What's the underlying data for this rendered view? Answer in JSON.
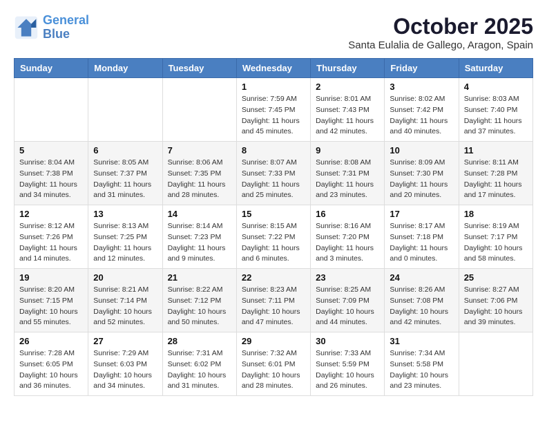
{
  "header": {
    "logo_line1": "General",
    "logo_line2": "Blue",
    "month": "October 2025",
    "location": "Santa Eulalia de Gallego, Aragon, Spain"
  },
  "days_of_week": [
    "Sunday",
    "Monday",
    "Tuesday",
    "Wednesday",
    "Thursday",
    "Friday",
    "Saturday"
  ],
  "weeks": [
    [
      {
        "day": "",
        "info": ""
      },
      {
        "day": "",
        "info": ""
      },
      {
        "day": "",
        "info": ""
      },
      {
        "day": "1",
        "info": "Sunrise: 7:59 AM\nSunset: 7:45 PM\nDaylight: 11 hours\nand 45 minutes."
      },
      {
        "day": "2",
        "info": "Sunrise: 8:01 AM\nSunset: 7:43 PM\nDaylight: 11 hours\nand 42 minutes."
      },
      {
        "day": "3",
        "info": "Sunrise: 8:02 AM\nSunset: 7:42 PM\nDaylight: 11 hours\nand 40 minutes."
      },
      {
        "day": "4",
        "info": "Sunrise: 8:03 AM\nSunset: 7:40 PM\nDaylight: 11 hours\nand 37 minutes."
      }
    ],
    [
      {
        "day": "5",
        "info": "Sunrise: 8:04 AM\nSunset: 7:38 PM\nDaylight: 11 hours\nand 34 minutes."
      },
      {
        "day": "6",
        "info": "Sunrise: 8:05 AM\nSunset: 7:37 PM\nDaylight: 11 hours\nand 31 minutes."
      },
      {
        "day": "7",
        "info": "Sunrise: 8:06 AM\nSunset: 7:35 PM\nDaylight: 11 hours\nand 28 minutes."
      },
      {
        "day": "8",
        "info": "Sunrise: 8:07 AM\nSunset: 7:33 PM\nDaylight: 11 hours\nand 25 minutes."
      },
      {
        "day": "9",
        "info": "Sunrise: 8:08 AM\nSunset: 7:31 PM\nDaylight: 11 hours\nand 23 minutes."
      },
      {
        "day": "10",
        "info": "Sunrise: 8:09 AM\nSunset: 7:30 PM\nDaylight: 11 hours\nand 20 minutes."
      },
      {
        "day": "11",
        "info": "Sunrise: 8:11 AM\nSunset: 7:28 PM\nDaylight: 11 hours\nand 17 minutes."
      }
    ],
    [
      {
        "day": "12",
        "info": "Sunrise: 8:12 AM\nSunset: 7:26 PM\nDaylight: 11 hours\nand 14 minutes."
      },
      {
        "day": "13",
        "info": "Sunrise: 8:13 AM\nSunset: 7:25 PM\nDaylight: 11 hours\nand 12 minutes."
      },
      {
        "day": "14",
        "info": "Sunrise: 8:14 AM\nSunset: 7:23 PM\nDaylight: 11 hours\nand 9 minutes."
      },
      {
        "day": "15",
        "info": "Sunrise: 8:15 AM\nSunset: 7:22 PM\nDaylight: 11 hours\nand 6 minutes."
      },
      {
        "day": "16",
        "info": "Sunrise: 8:16 AM\nSunset: 7:20 PM\nDaylight: 11 hours\nand 3 minutes."
      },
      {
        "day": "17",
        "info": "Sunrise: 8:17 AM\nSunset: 7:18 PM\nDaylight: 11 hours\nand 0 minutes."
      },
      {
        "day": "18",
        "info": "Sunrise: 8:19 AM\nSunset: 7:17 PM\nDaylight: 10 hours\nand 58 minutes."
      }
    ],
    [
      {
        "day": "19",
        "info": "Sunrise: 8:20 AM\nSunset: 7:15 PM\nDaylight: 10 hours\nand 55 minutes."
      },
      {
        "day": "20",
        "info": "Sunrise: 8:21 AM\nSunset: 7:14 PM\nDaylight: 10 hours\nand 52 minutes."
      },
      {
        "day": "21",
        "info": "Sunrise: 8:22 AM\nSunset: 7:12 PM\nDaylight: 10 hours\nand 50 minutes."
      },
      {
        "day": "22",
        "info": "Sunrise: 8:23 AM\nSunset: 7:11 PM\nDaylight: 10 hours\nand 47 minutes."
      },
      {
        "day": "23",
        "info": "Sunrise: 8:25 AM\nSunset: 7:09 PM\nDaylight: 10 hours\nand 44 minutes."
      },
      {
        "day": "24",
        "info": "Sunrise: 8:26 AM\nSunset: 7:08 PM\nDaylight: 10 hours\nand 42 minutes."
      },
      {
        "day": "25",
        "info": "Sunrise: 8:27 AM\nSunset: 7:06 PM\nDaylight: 10 hours\nand 39 minutes."
      }
    ],
    [
      {
        "day": "26",
        "info": "Sunrise: 7:28 AM\nSunset: 6:05 PM\nDaylight: 10 hours\nand 36 minutes."
      },
      {
        "day": "27",
        "info": "Sunrise: 7:29 AM\nSunset: 6:03 PM\nDaylight: 10 hours\nand 34 minutes."
      },
      {
        "day": "28",
        "info": "Sunrise: 7:31 AM\nSunset: 6:02 PM\nDaylight: 10 hours\nand 31 minutes."
      },
      {
        "day": "29",
        "info": "Sunrise: 7:32 AM\nSunset: 6:01 PM\nDaylight: 10 hours\nand 28 minutes."
      },
      {
        "day": "30",
        "info": "Sunrise: 7:33 AM\nSunset: 5:59 PM\nDaylight: 10 hours\nand 26 minutes."
      },
      {
        "day": "31",
        "info": "Sunrise: 7:34 AM\nSunset: 5:58 PM\nDaylight: 10 hours\nand 23 minutes."
      },
      {
        "day": "",
        "info": ""
      }
    ]
  ]
}
